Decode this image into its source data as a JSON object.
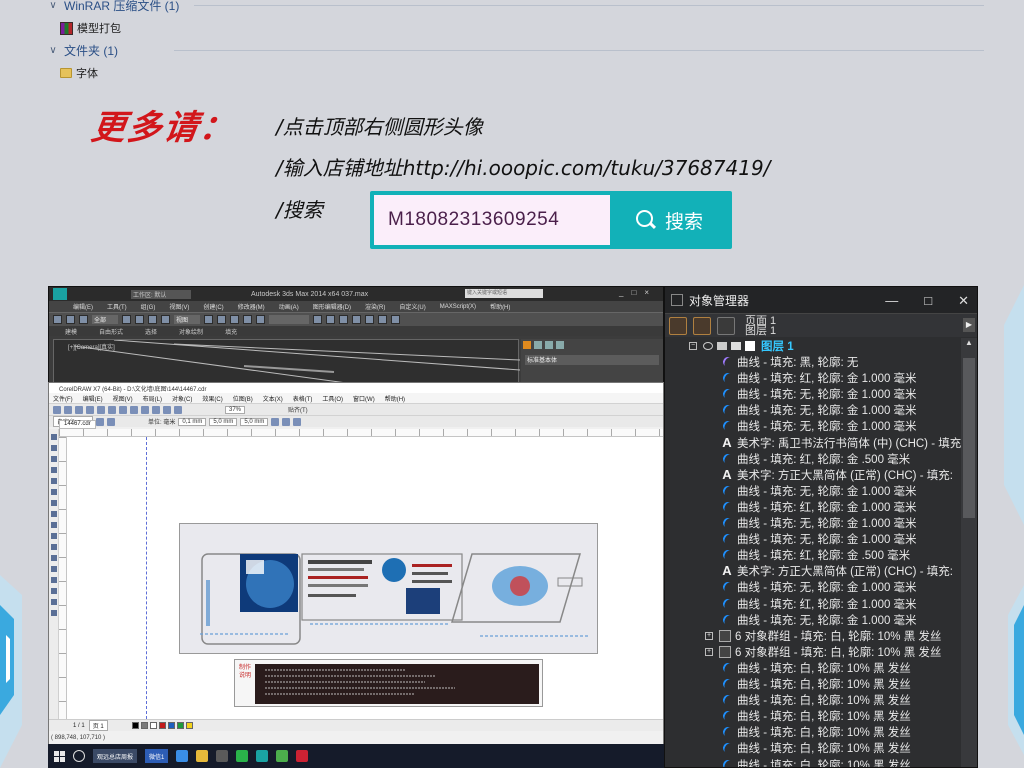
{
  "explorer": {
    "groups": [
      {
        "label": "WinRAR 压缩文件 (1)",
        "items": [
          "模型打包"
        ]
      },
      {
        "label": "文件夹 (1)",
        "items": [
          "字体"
        ]
      }
    ]
  },
  "promo": {
    "title": "更多请：",
    "lines": [
      "/点击顶部右侧圆形头像",
      "/输入店铺地址http://hi.ooopic.com/tuku/37687419/",
      "/搜索"
    ],
    "search_value": "M18082313609254",
    "search_button": "搜索"
  },
  "max_window": {
    "title": "Autodesk 3ds Max  2014 x64        037.max",
    "workspace": "工作区: 默认",
    "search_placeholder": "键入关键字或短语",
    "menu": [
      "编辑(E)",
      "工具(T)",
      "组(G)",
      "视图(V)",
      "创建(C)",
      "修改器(M)",
      "动画(A)",
      "图形编辑器(D)",
      "渲染(R)",
      "自定义(U)",
      "MAXScript(X)",
      "帮助(H)"
    ],
    "tabs": [
      "建模",
      "自由形式",
      "选择",
      "对象绘制",
      "填充"
    ],
    "dropdown_all": "全部",
    "dropdown_view": "视图",
    "panel_label": "标准基本体",
    "viewport_label": "[+][Camera][真实]"
  },
  "corel_window": {
    "title": "CorelDRAW X7 (64-Bit) - D:\\文化墙\\底图\\144\\14467.cdr",
    "menu": [
      "文件(F)",
      "编辑(E)",
      "视图(V)",
      "布局(L)",
      "对象(C)",
      "效果(C)",
      "位图(B)",
      "文本(X)",
      "表格(T)",
      "工具(O)",
      "窗口(W)",
      "帮助(H)"
    ],
    "zoom": "37%",
    "snap": "贴齐(T)",
    "unit": "单位: 毫米",
    "size_w": "5,0 mm",
    "size_h": "5,0 mm",
    "nudge": "0,1 mm",
    "paper": "自定义",
    "tab": "14467.cdr",
    "note_label": "制作说明",
    "page_nav": "1 / 1",
    "page_name": "页 1",
    "coords": "( 898,748, 107,710 )",
    "swatches": [
      "#000000",
      "#7a7a7a",
      "#ffffff",
      "#c21b1b",
      "#1e5fbf",
      "#1d9a3c",
      "#f2d21b"
    ]
  },
  "taskbar": {
    "apps": [
      "观远总店周报",
      "微信1"
    ]
  },
  "object_manager": {
    "title": "对象管理器",
    "page": "页面 1",
    "layer_label": "图层 1",
    "layer": "图层 1",
    "rows": [
      {
        "icon": "curve-purple",
        "text": "曲线 - 填充: 黑, 轮廓: 无"
      },
      {
        "icon": "curve",
        "text": "曲线 - 填充: 红, 轮廓: 金 1.000 毫米"
      },
      {
        "icon": "curve",
        "text": "曲线 - 填充: 无, 轮廓: 金 1.000 毫米"
      },
      {
        "icon": "curve",
        "text": "曲线 - 填充: 无, 轮廓: 金 1.000 毫米"
      },
      {
        "icon": "curve",
        "text": "曲线 - 填充: 无, 轮廓: 金 1.000 毫米"
      },
      {
        "icon": "text",
        "text": "美术字: 禹卫书法行书简体 (中) (CHC) - 填充"
      },
      {
        "icon": "curve",
        "text": "曲线 - 填充: 红, 轮廓: 金 .500 毫米"
      },
      {
        "icon": "text",
        "text": "美术字: 方正大黑简体 (正常) (CHC) - 填充:"
      },
      {
        "icon": "curve",
        "text": "曲线 - 填充: 无, 轮廓: 金 1.000 毫米"
      },
      {
        "icon": "curve",
        "text": "曲线 - 填充: 红, 轮廓: 金 1.000 毫米"
      },
      {
        "icon": "curve",
        "text": "曲线 - 填充: 无, 轮廓: 金 1.000 毫米"
      },
      {
        "icon": "curve",
        "text": "曲线 - 填充: 无, 轮廓: 金 1.000 毫米"
      },
      {
        "icon": "curve",
        "text": "曲线 - 填充: 红, 轮廓: 金 .500 毫米"
      },
      {
        "icon": "text",
        "text": "美术字: 方正大黑简体 (正常) (CHC) - 填充:"
      },
      {
        "icon": "curve",
        "text": "曲线 - 填充: 无, 轮廓: 金 1.000 毫米"
      },
      {
        "icon": "curve",
        "text": "曲线 - 填充: 红, 轮廓: 金 1.000 毫米"
      },
      {
        "icon": "curve",
        "text": "曲线 - 填充: 无, 轮廓: 金 1.000 毫米"
      },
      {
        "icon": "group",
        "text": "6 对象群组 - 填充: 白, 轮廓: 10% 黑 发丝"
      },
      {
        "icon": "group",
        "text": "6 对象群组 - 填充: 白, 轮廓: 10% 黑 发丝"
      },
      {
        "icon": "curve",
        "text": "曲线 - 填充: 白, 轮廓: 10% 黑 发丝"
      },
      {
        "icon": "curve",
        "text": "曲线 - 填充: 白, 轮廓: 10% 黑 发丝"
      },
      {
        "icon": "curve",
        "text": "曲线 - 填充: 白, 轮廓: 10% 黑 发丝"
      },
      {
        "icon": "curve",
        "text": "曲线 - 填充: 白, 轮廓: 10% 黑 发丝"
      },
      {
        "icon": "curve",
        "text": "曲线 - 填充: 白, 轮廓: 10% 黑 发丝"
      },
      {
        "icon": "curve",
        "text": "曲线 - 填充: 白, 轮廓: 10% 黑 发丝"
      },
      {
        "icon": "curve",
        "text": "曲线 - 填充: 白, 轮廓: 10% 黑 发丝"
      },
      {
        "icon": "curve",
        "text": "曲线 - 填充: 白, 轮廓: 10% 黑 发丝"
      }
    ]
  },
  "colors": {
    "promo_red": "#d2161b",
    "search_teal": "#12b1b8",
    "layer_blue": "#35c8ff",
    "panel_dark": "#2d2e30"
  }
}
